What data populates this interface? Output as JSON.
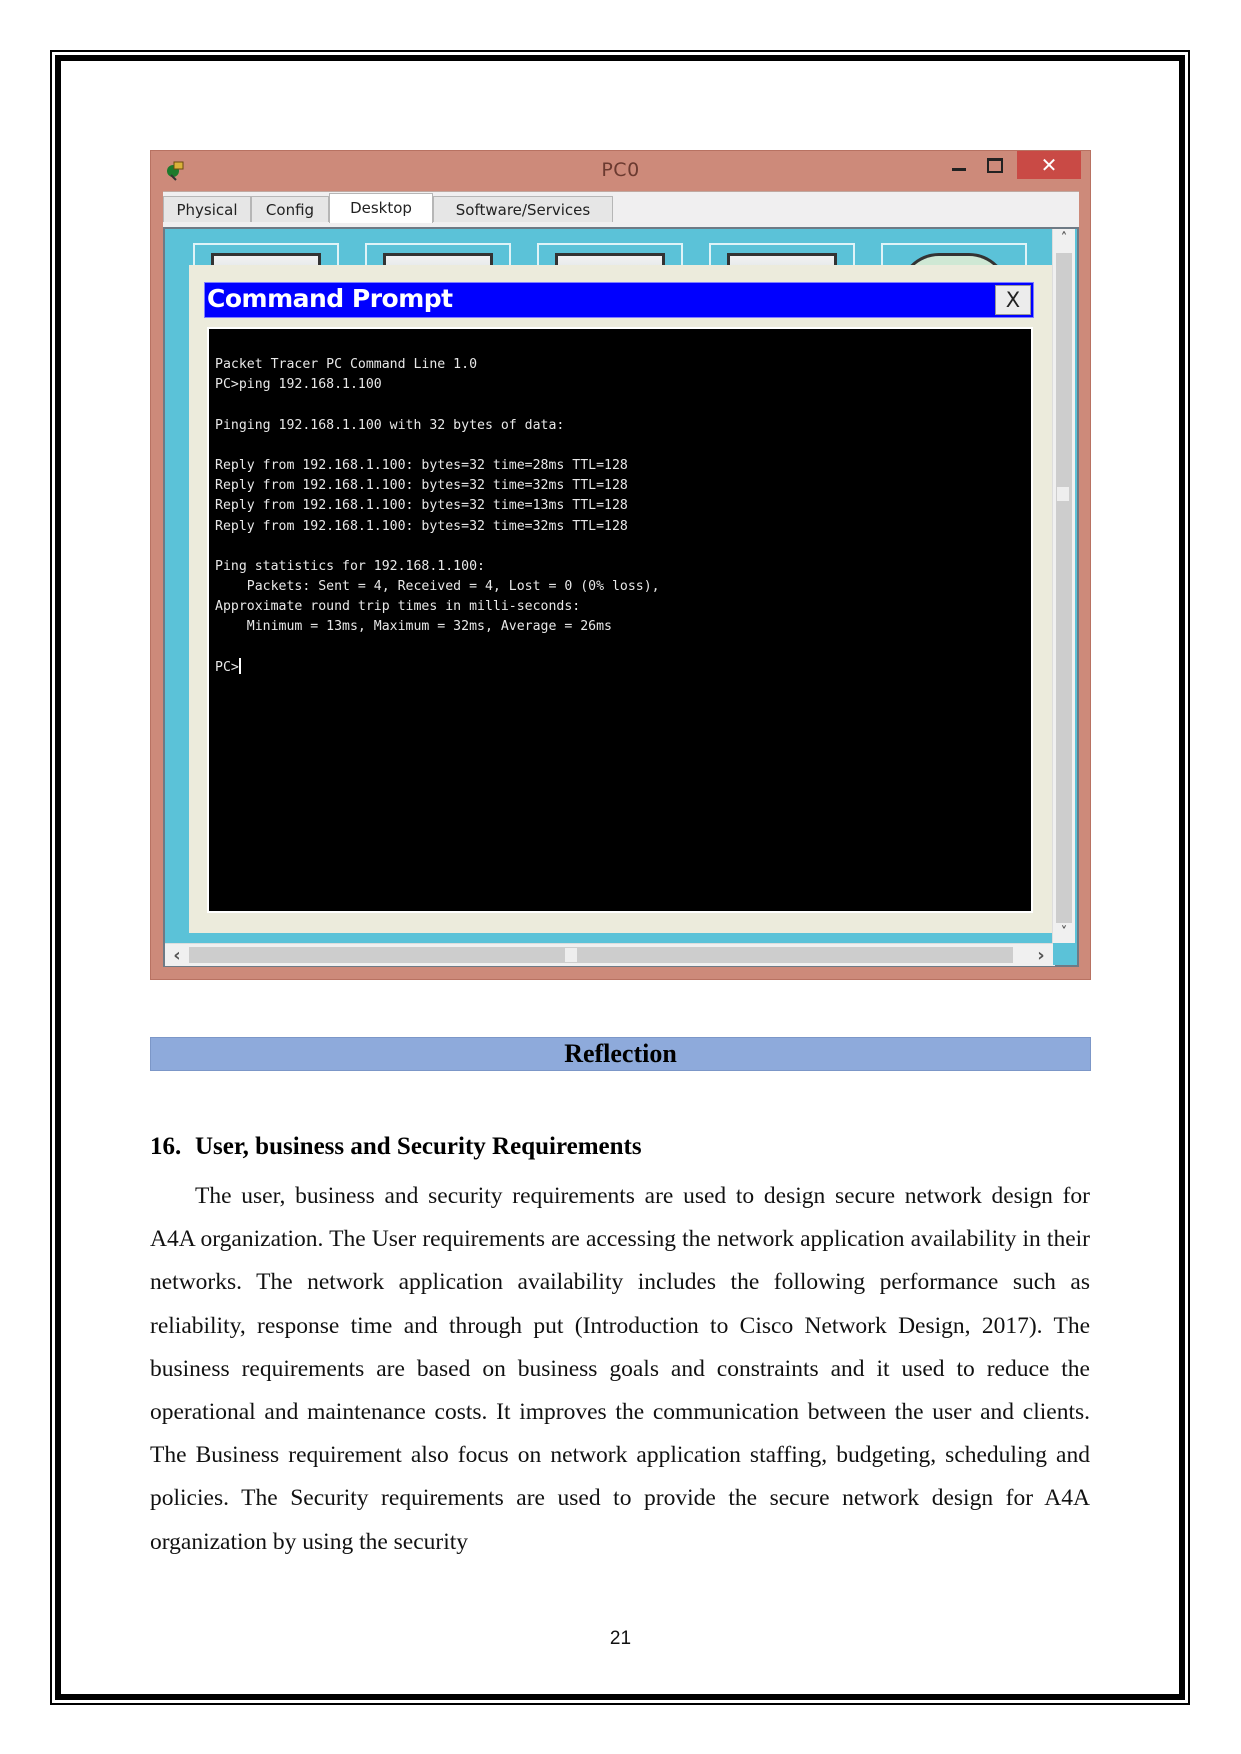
{
  "window": {
    "title": "PC0",
    "controls": {
      "minimize": "–",
      "maximize": "□",
      "close": "✕"
    },
    "tabs": [
      {
        "label": "Physical",
        "active": false
      },
      {
        "label": "Config",
        "active": false
      },
      {
        "label": "Desktop",
        "active": true
      },
      {
        "label": "Software/Services",
        "active": false
      }
    ],
    "scroll_arrows": {
      "up": "˄",
      "down": "˅",
      "left": "‹",
      "right": "›"
    },
    "colors": {
      "titlebar": "#cd8a7a",
      "close": "#c94a45",
      "desktop_bg": "#5bc2d8",
      "cmd_title": "#0000ff"
    }
  },
  "command_prompt": {
    "title": "Command Prompt",
    "close_label": "X",
    "lines": [
      "Packet Tracer PC Command Line 1.0",
      "PC>ping 192.168.1.100",
      "",
      "Pinging 192.168.1.100 with 32 bytes of data:",
      "",
      "Reply from 192.168.1.100: bytes=32 time=28ms TTL=128",
      "Reply from 192.168.1.100: bytes=32 time=32ms TTL=128",
      "Reply from 192.168.1.100: bytes=32 time=13ms TTL=128",
      "Reply from 192.168.1.100: bytes=32 time=32ms TTL=128",
      "",
      "Ping statistics for 192.168.1.100:",
      "    Packets: Sent = 4, Received = 4, Lost = 0 (0% loss),",
      "Approximate round trip times in milli-seconds:",
      "    Minimum = 13ms, Maximum = 32ms, Average = 26ms",
      ""
    ],
    "prompt": "PC>"
  },
  "document": {
    "reflection_title": "Reflection",
    "section_number": "16.",
    "section_title": "User, business and Security Requirements",
    "paragraph": "The user, business and security requirements are used to design secure network design for A4A organization. The User requirements are accessing the network application availability in their networks. The network application availability includes the following performance such as reliability, response time and through put (Introduction to Cisco Network Design, 2017). The business requirements are based on business goals and constraints and it used to reduce the operational and maintenance costs. It improves the communication between the user and clients. The Business requirement also focus on network application staffing, budgeting, scheduling and policies. The Security requirements are used to provide the secure network design for A4A organization by using the security",
    "page_number": "21"
  }
}
